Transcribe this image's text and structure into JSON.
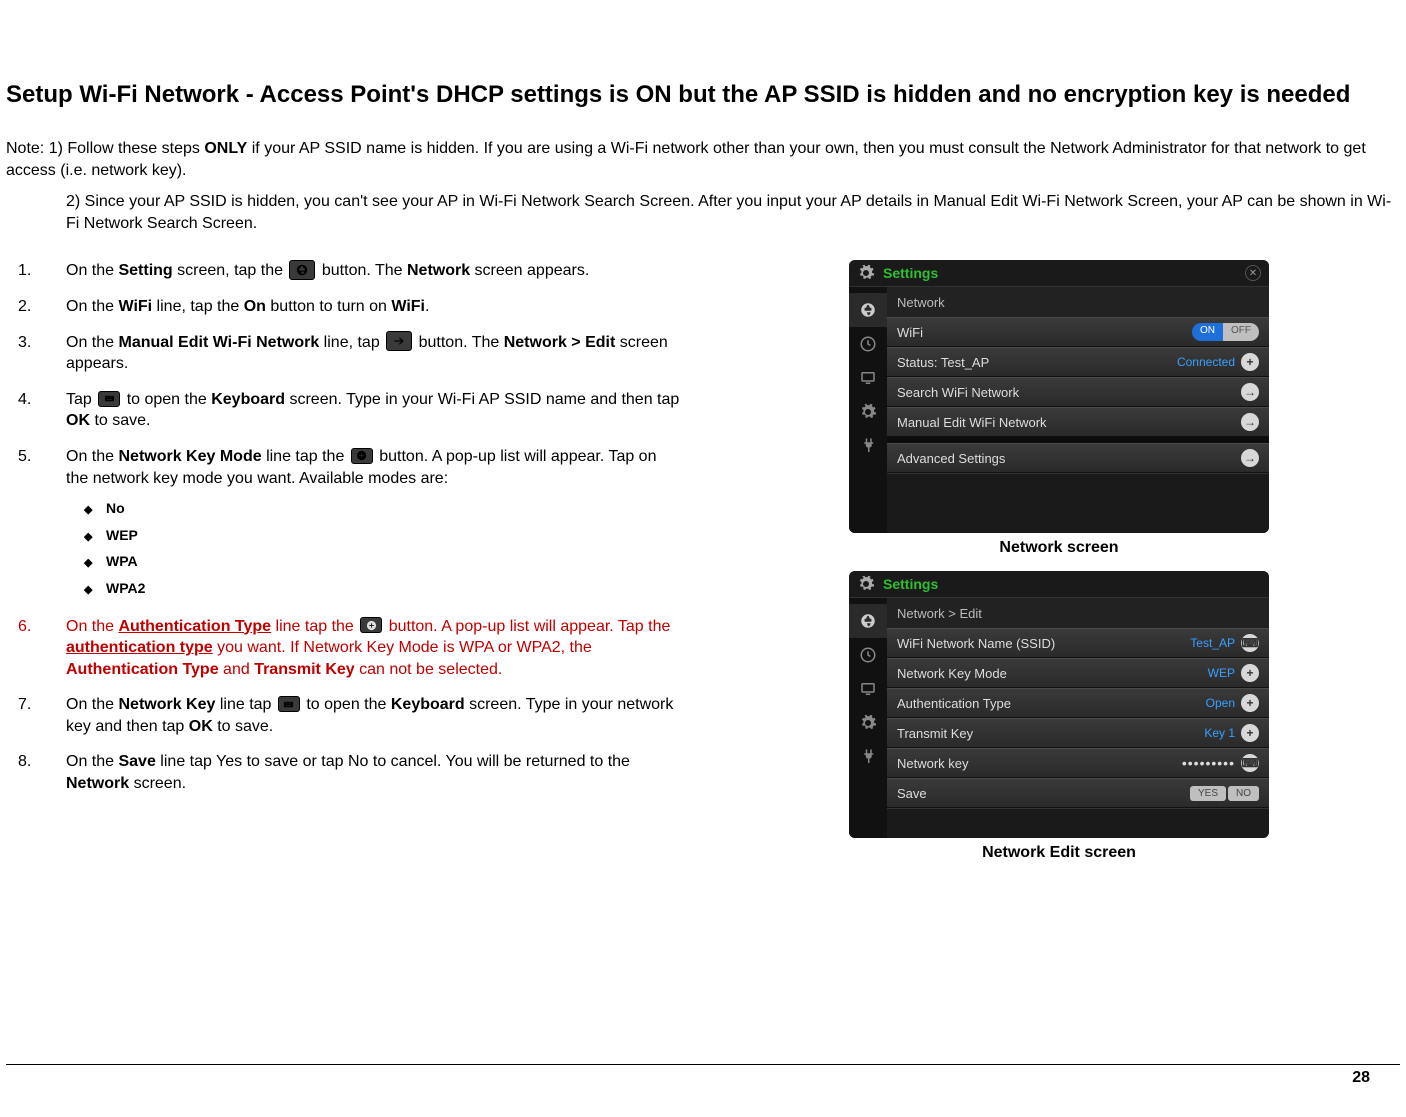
{
  "heading": "Setup Wi-Fi Network - Access Point's DHCP settings is ON but the AP SSID is hidden and no encryption key is needed",
  "notes": {
    "prefix": "Note: 1) Follow these steps ",
    "only": "ONLY",
    "line1_rest": " if your AP SSID name is hidden.  If you are using a Wi-Fi network other than your own, then you must consult the Network Administrator for that network to get access (i.e. network key).",
    "line2": "2)  Since your AP SSID is hidden, you can't see your AP in Wi-Fi Network Search Screen.  After you input your AP details in Manual Edit Wi-Fi Network Screen, your AP can be shown in Wi-Fi Network Search Screen."
  },
  "steps": {
    "s1a": "On the ",
    "s1b": "Setting",
    "s1c": " screen, tap the ",
    "s1d": " button.  The ",
    "s1e": "Network",
    "s1f": " screen appears.",
    "s2a": "On the ",
    "s2b": "WiFi",
    "s2c": " line, tap the ",
    "s2d": "On",
    "s2e": " button to turn on ",
    "s2f": "WiFi",
    "s2g": ".",
    "s3a": "On the ",
    "s3b": "Manual Edit Wi-Fi Network",
    "s3c": " line, tap ",
    "s3d": " button.  The ",
    "s3e": "Network > Edit",
    "s3f": " screen appears.",
    "s4a": "Tap ",
    "s4b": " to open the ",
    "s4c": "Keyboard",
    "s4d": " screen.  Type in your Wi-Fi AP SSID name and then tap ",
    "s4e": "OK",
    "s4f": " to save.",
    "s5a": "On the ",
    "s5b": "Network Key Mode",
    "s5c": " line tap the ",
    "s5d": " button.  A pop-up list will appear.  Tap on the network key mode you want.  Available modes are:",
    "s6a": "On the ",
    "s6b": "Authentication Type",
    "s6c": " line tap the ",
    "s6d": " button.  A pop-up list will appear.  Tap the ",
    "s6e": "authentication type",
    "s6f": " you want. If Network Key Mode is WPA or WPA2, the ",
    "s6g": "Authentication Type",
    "s6h": " and ",
    "s6i": "Transmit Key",
    "s6j": " can not be selected.",
    "s7a": "On the ",
    "s7b": "Network Key",
    "s7c": " line tap ",
    "s7d": " to open the ",
    "s7e": "Keyboard",
    "s7f": " screen.  Type in your network key and then tap ",
    "s7g": "OK",
    "s7h": " to save.",
    "s8a": "On the ",
    "s8b": "Save",
    "s8c": " line tap Yes to save or tap No to cancel.  You will be returned to the ",
    "s8d": "Network",
    "s8e": " screen."
  },
  "modes": [
    "No",
    "WEP",
    "WPA",
    "WPA2"
  ],
  "captions": {
    "c1": "Network screen",
    "c2": "Network Edit screen"
  },
  "mock1": {
    "title": "Settings",
    "subhead": "Network",
    "rows": {
      "wifi": "WiFi",
      "on": "ON",
      "off": "OFF",
      "status_lbl": "Status: Test_AP",
      "status_val": "Connected",
      "search": "Search WiFi Network",
      "manual": "Manual Edit WiFi Network",
      "adv": "Advanced Settings"
    }
  },
  "mock2": {
    "title": "Settings",
    "subhead": "Network > Edit",
    "rows": {
      "ssid_lbl": "WiFi Network Name (SSID)",
      "ssid_val": "Test_AP",
      "mode_lbl": "Network Key Mode",
      "mode_val": "WEP",
      "auth_lbl": "Authentication Type",
      "auth_val": "Open",
      "tx_lbl": "Transmit Key",
      "tx_val": "Key 1",
      "key_lbl": "Network key",
      "key_val": "•••••••••",
      "save_lbl": "Save",
      "yes": "YES",
      "no": "NO"
    }
  },
  "page_number": "28"
}
